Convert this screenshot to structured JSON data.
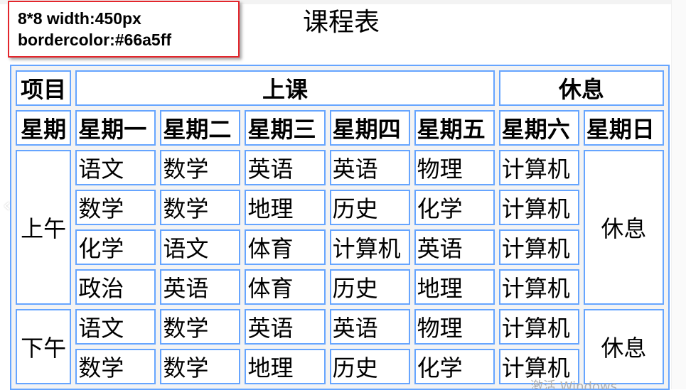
{
  "note": {
    "line1": "8*8  width:450px",
    "line2": "bordercolor:#66a5ff"
  },
  "title": "课程表",
  "header": {
    "item": "项目",
    "class": "上课",
    "rest": "休息"
  },
  "days": [
    "星期",
    "星期一",
    "星期二",
    "星期三",
    "星期四",
    "星期五",
    "星期六",
    "星期日"
  ],
  "morning": {
    "label": "上午",
    "rows": [
      [
        "语文",
        "数学",
        "英语",
        "英语",
        "物理",
        "计算机"
      ],
      [
        "数学",
        "数学",
        "地理",
        "历史",
        "化学",
        "计算机"
      ],
      [
        "化学",
        "语文",
        "体育",
        "计算机",
        "英语",
        "计算机"
      ],
      [
        "政治",
        "英语",
        "体育",
        "历史",
        "地理",
        "计算机"
      ]
    ],
    "sunday": "休息"
  },
  "afternoon": {
    "label": "下午",
    "rows": [
      [
        "语文",
        "数学",
        "英语",
        "英语",
        "物理",
        "计算机"
      ],
      [
        "数学",
        "数学",
        "地理",
        "历史",
        "化学",
        "计算机"
      ]
    ],
    "sunday": "休息"
  },
  "watermark": "激活 Windows",
  "colors": {
    "border": "#66a5ff",
    "note_border": "#e3262c",
    "background": "#f3f3f3"
  }
}
